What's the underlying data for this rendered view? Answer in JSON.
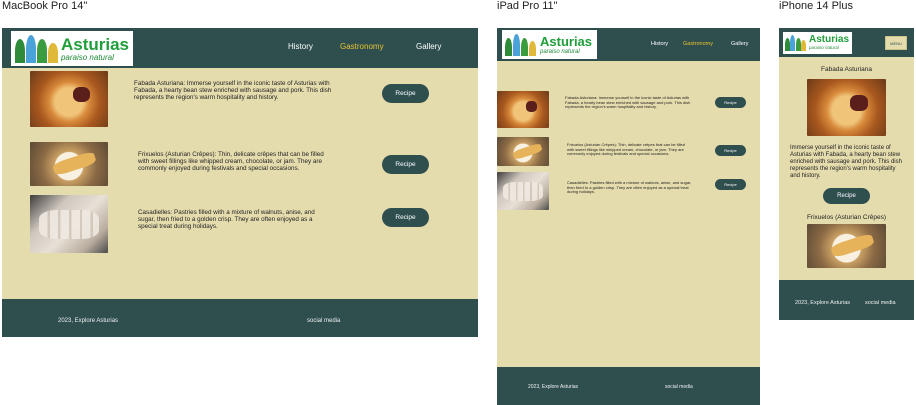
{
  "frames": {
    "macbook": "MacBook Pro 14\"",
    "ipad": "iPad Pro 11\"",
    "iphone": "iPhone 14 Plus"
  },
  "brand": {
    "title": "Asturias",
    "subtitle": "paraiso natural"
  },
  "nav": {
    "history": "History",
    "gastronomy": "Gastronomy",
    "gallery": "Gallery",
    "menu": "MENU"
  },
  "dishes": [
    {
      "name": "Fabada Asturiana",
      "description": "Fabada Asturiana: Immerse yourself in the iconic taste of Asturias with Fabada, a hearty bean stew enriched with sausage and pork. This dish represents the region's warm hospitality and history.",
      "short_description": "Immerse yourself in the iconic taste of Asturias with Fabada, a hearty bean stew enriched with sausage and pork. This dish represents the region's warm hospitality and history.",
      "button": "Recipe"
    },
    {
      "name": "Frixuelos (Asturian Crêpes)",
      "description": "Frixuelos (Asturian Crêpes): Thin, delicate crêpes that can be filled with sweet fillings like whipped cream, chocolate, or jam. They are commonly enjoyed during festivals and special occasions.",
      "button": "Recipe"
    },
    {
      "name": "Casadielles",
      "description": "Casadielles: Pastries filled with a mixture of walnuts, anise, and sugar, then fried to a golden crisp. They are often enjoyed as a special treat during holidays.",
      "button": "Recipe"
    }
  ],
  "footer": {
    "copyright": "2023, Explore Asturias",
    "social": "social media"
  },
  "colors": {
    "header": "#2f4f4f",
    "background": "#e5dcae",
    "accent": "#e8c230",
    "brand_green": "#1f9e3a"
  }
}
